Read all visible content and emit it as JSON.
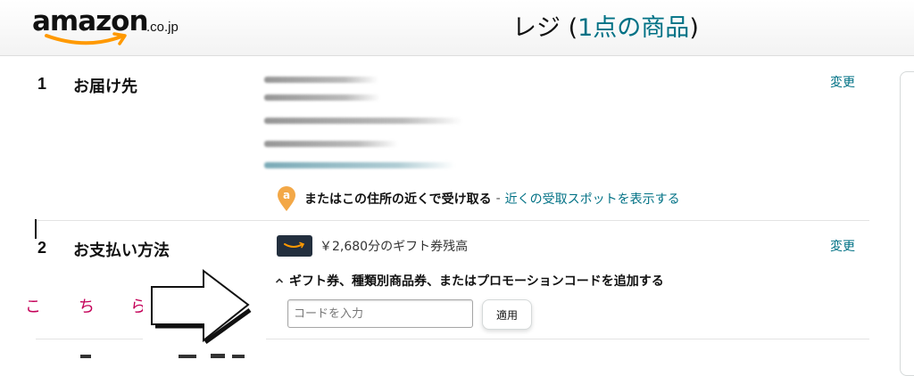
{
  "header": {
    "logo_text": "amazon",
    "logo_suffix": ".co.jp",
    "title_prefix": "レジ (",
    "title_count_link": "1点の商品",
    "title_suffix": ")"
  },
  "sections": {
    "shipping": {
      "number": "1",
      "title": "お届け先",
      "change_label": "変更",
      "pickup_icon_letter": "a",
      "pickup_text": "またはこの住所の近くで受け取る",
      "pickup_separator": "-",
      "pickup_link": "近くの受取スポットを表示する"
    },
    "payment": {
      "number": "2",
      "title": "お支払い方法",
      "change_label": "変更",
      "gift_balance": "￥2,680分のギフト券残高",
      "promo_toggle_icon": "chevron-up-icon",
      "promo_label": "ギフト券、種類別商品券、またはプロモーションコードを追加する",
      "code_placeholder": "コードを入力",
      "code_value": "",
      "apply_label": "適用"
    }
  },
  "annotation": {
    "text_chars": [
      "こ",
      "ち",
      "ら"
    ],
    "color": "#c40058",
    "arrow_icon": "right-arrow-icon"
  },
  "colors": {
    "link": "#007185",
    "card": "#232f3e",
    "pickup_pin": "#f3a847",
    "smile": "#ff9900"
  }
}
